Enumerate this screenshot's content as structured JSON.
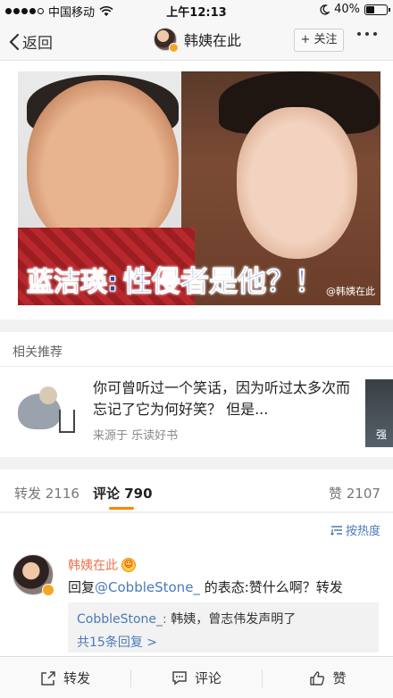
{
  "status_bar": {
    "carrier": "中国移动",
    "time": "上午12:13",
    "battery_percent": "40%",
    "battery_level": 0.4
  },
  "nav": {
    "back_label": "返回",
    "title": "韩姨在此",
    "follow_label": "+ 关注"
  },
  "post": {
    "caption_name": "蓝洁瑛:",
    "caption_text": "性侵者是他？！",
    "watermark": "@韩姨在此"
  },
  "related": {
    "title": "相关推荐",
    "item_text": "你可曾听过一个笑话，因为听过太多次而忘记了它为何好笑？ 但是...",
    "source": "来源于 乐读好书",
    "next_label": "强"
  },
  "tabs": {
    "repost": "转发 2116",
    "comment": "评论 790",
    "like": "赞 2107"
  },
  "comments": {
    "sort_label": "按热度",
    "items": [
      {
        "name": "韩姨在此",
        "prefix": "回复",
        "mention": "@CobbleStone_",
        "suffix": " 的表态:赞什么啊？转发",
        "reply_who": "CobbleStone_:",
        "reply_text": " 韩姨，曾志伟发声明了",
        "reply_more": "共15条回复 >"
      }
    ]
  },
  "bottom_bar": {
    "repost": "转发",
    "comment": "评论",
    "like": "赞"
  },
  "icons": {
    "back": "chevron-left-icon",
    "wifi": "wifi-icon",
    "moon": "moon-icon",
    "sort": "sort-icon",
    "repost": "share-icon",
    "comment": "comment-icon",
    "like": "thumbs-up-icon"
  }
}
